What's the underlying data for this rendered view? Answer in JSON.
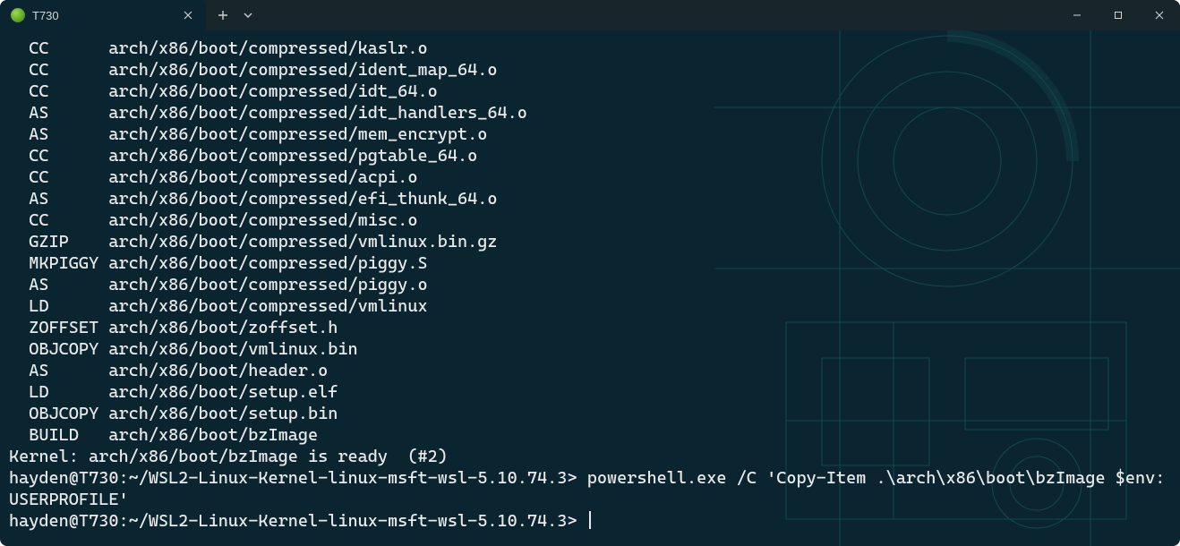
{
  "window": {
    "tab_title": "T730"
  },
  "build_lines": [
    {
      "stage": "CC",
      "path": "arch/x86/boot/compressed/kaslr.o"
    },
    {
      "stage": "CC",
      "path": "arch/x86/boot/compressed/ident_map_64.o"
    },
    {
      "stage": "CC",
      "path": "arch/x86/boot/compressed/idt_64.o"
    },
    {
      "stage": "AS",
      "path": "arch/x86/boot/compressed/idt_handlers_64.o"
    },
    {
      "stage": "AS",
      "path": "arch/x86/boot/compressed/mem_encrypt.o"
    },
    {
      "stage": "CC",
      "path": "arch/x86/boot/compressed/pgtable_64.o"
    },
    {
      "stage": "CC",
      "path": "arch/x86/boot/compressed/acpi.o"
    },
    {
      "stage": "AS",
      "path": "arch/x86/boot/compressed/efi_thunk_64.o"
    },
    {
      "stage": "CC",
      "path": "arch/x86/boot/compressed/misc.o"
    },
    {
      "stage": "GZIP",
      "path": "arch/x86/boot/compressed/vmlinux.bin.gz"
    },
    {
      "stage": "MKPIGGY",
      "path": "arch/x86/boot/compressed/piggy.S"
    },
    {
      "stage": "AS",
      "path": "arch/x86/boot/compressed/piggy.o"
    },
    {
      "stage": "LD",
      "path": "arch/x86/boot/compressed/vmlinux"
    },
    {
      "stage": "ZOFFSET",
      "path": "arch/x86/boot/zoffset.h"
    },
    {
      "stage": "OBJCOPY",
      "path": "arch/x86/boot/vmlinux.bin"
    },
    {
      "stage": "AS",
      "path": "arch/x86/boot/header.o"
    },
    {
      "stage": "LD",
      "path": "arch/x86/boot/setup.elf"
    },
    {
      "stage": "OBJCOPY",
      "path": "arch/x86/boot/setup.bin"
    },
    {
      "stage": "BUILD",
      "path": "arch/x86/boot/bzImage"
    }
  ],
  "kernel_ready": "Kernel: arch/x86/boot/bzImage is ready  (#2)",
  "prompt1": "hayden@T730:~/WSL2-Linux-Kernel-linux-msft-wsl-5.10.74.3>",
  "command1": "powershell.exe /C 'Copy-Item .\\arch\\x86\\boot\\bzImage $env:USERPROFILE'",
  "prompt2": "hayden@T730:~/WSL2-Linux-Kernel-linux-msft-wsl-5.10.74.3>"
}
